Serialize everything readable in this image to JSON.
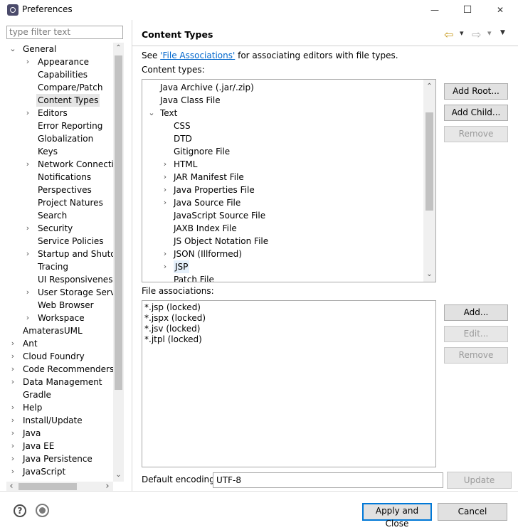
{
  "window": {
    "title": "Preferences",
    "minimize": "—",
    "maximize": "☐",
    "close": "✕"
  },
  "filter": {
    "placeholder": "type filter text"
  },
  "tree": {
    "general": {
      "label": "General",
      "twisty": "⌄"
    },
    "general_children": [
      {
        "label": "Appearance",
        "twisty": "›"
      },
      {
        "label": "Capabilities",
        "twisty": ""
      },
      {
        "label": "Compare/Patch",
        "twisty": ""
      },
      {
        "label": "Content Types",
        "twisty": "",
        "selected": true
      },
      {
        "label": "Editors",
        "twisty": "›"
      },
      {
        "label": "Error Reporting",
        "twisty": ""
      },
      {
        "label": "Globalization",
        "twisty": ""
      },
      {
        "label": "Keys",
        "twisty": ""
      },
      {
        "label": "Network Connection",
        "twisty": "›"
      },
      {
        "label": "Notifications",
        "twisty": ""
      },
      {
        "label": "Perspectives",
        "twisty": ""
      },
      {
        "label": "Project Natures",
        "twisty": ""
      },
      {
        "label": "Search",
        "twisty": ""
      },
      {
        "label": "Security",
        "twisty": "›"
      },
      {
        "label": "Service Policies",
        "twisty": ""
      },
      {
        "label": "Startup and Shutdown",
        "twisty": "›"
      },
      {
        "label": "Tracing",
        "twisty": ""
      },
      {
        "label": "UI Responsiveness M",
        "twisty": ""
      },
      {
        "label": "User Storage Service",
        "twisty": "›"
      },
      {
        "label": "Web Browser",
        "twisty": ""
      },
      {
        "label": "Workspace",
        "twisty": "›"
      }
    ],
    "root_items": [
      {
        "label": "AmaterasUML",
        "twisty": ""
      },
      {
        "label": "Ant",
        "twisty": "›"
      },
      {
        "label": "Cloud Foundry",
        "twisty": "›"
      },
      {
        "label": "Code Recommenders",
        "twisty": "›"
      },
      {
        "label": "Data Management",
        "twisty": "›"
      },
      {
        "label": "Gradle",
        "twisty": ""
      },
      {
        "label": "Help",
        "twisty": "›"
      },
      {
        "label": "Install/Update",
        "twisty": "›"
      },
      {
        "label": "Java",
        "twisty": "›"
      },
      {
        "label": "Java EE",
        "twisty": "›"
      },
      {
        "label": "Java Persistence",
        "twisty": "›"
      },
      {
        "label": "JavaScript",
        "twisty": "›"
      }
    ]
  },
  "page": {
    "title": "Content Types",
    "see_prefix": "See ",
    "see_link": "'File Associations'",
    "see_suffix": " for associating editors with file types.",
    "content_types_label": "Content types:"
  },
  "content_types": [
    {
      "label": "Java Archive (.jar/.zip)",
      "indent": 0,
      "twisty": ""
    },
    {
      "label": "Java Class File",
      "indent": 0,
      "twisty": ""
    },
    {
      "label": "Text",
      "indent": 0,
      "twisty": "⌄"
    },
    {
      "label": "CSS",
      "indent": 1,
      "twisty": ""
    },
    {
      "label": "DTD",
      "indent": 1,
      "twisty": ""
    },
    {
      "label": "Gitignore File",
      "indent": 1,
      "twisty": ""
    },
    {
      "label": "HTML",
      "indent": 1,
      "twisty": "›"
    },
    {
      "label": "JAR Manifest File",
      "indent": 1,
      "twisty": "›"
    },
    {
      "label": "Java Properties File",
      "indent": 1,
      "twisty": "›"
    },
    {
      "label": "Java Source File",
      "indent": 1,
      "twisty": "›"
    },
    {
      "label": "JavaScript Source File",
      "indent": 1,
      "twisty": ""
    },
    {
      "label": "JAXB Index File",
      "indent": 1,
      "twisty": ""
    },
    {
      "label": "JS Object Notation File",
      "indent": 1,
      "twisty": ""
    },
    {
      "label": "JSON (Illformed)",
      "indent": 1,
      "twisty": "›"
    },
    {
      "label": "JSP",
      "indent": 1,
      "twisty": "›",
      "selected": true
    },
    {
      "label": "Patch File",
      "indent": 1,
      "twisty": ""
    }
  ],
  "buttons": {
    "add_root": "Add Root...",
    "add_child": "Add Child...",
    "remove": "Remove",
    "add": "Add...",
    "edit": "Edit...",
    "remove2": "Remove",
    "update": "Update",
    "apply_close": "Apply and Close",
    "cancel": "Cancel"
  },
  "file_associations": {
    "label": "File associations:",
    "items": [
      "*.jsp (locked)",
      "*.jspx (locked)",
      "*.jsv (locked)",
      "*.jtpl (locked)"
    ]
  },
  "encoding": {
    "label": "Default encoding:",
    "value": "UTF-8"
  },
  "icons": {
    "help": "?",
    "back_arrow": "⇦",
    "forward_arrow": "⇨",
    "dropdown": "▾",
    "menu": "▼",
    "scroll_up": "⌃",
    "scroll_down": "⌄",
    "scroll_left": "‹",
    "scroll_right": "›"
  }
}
